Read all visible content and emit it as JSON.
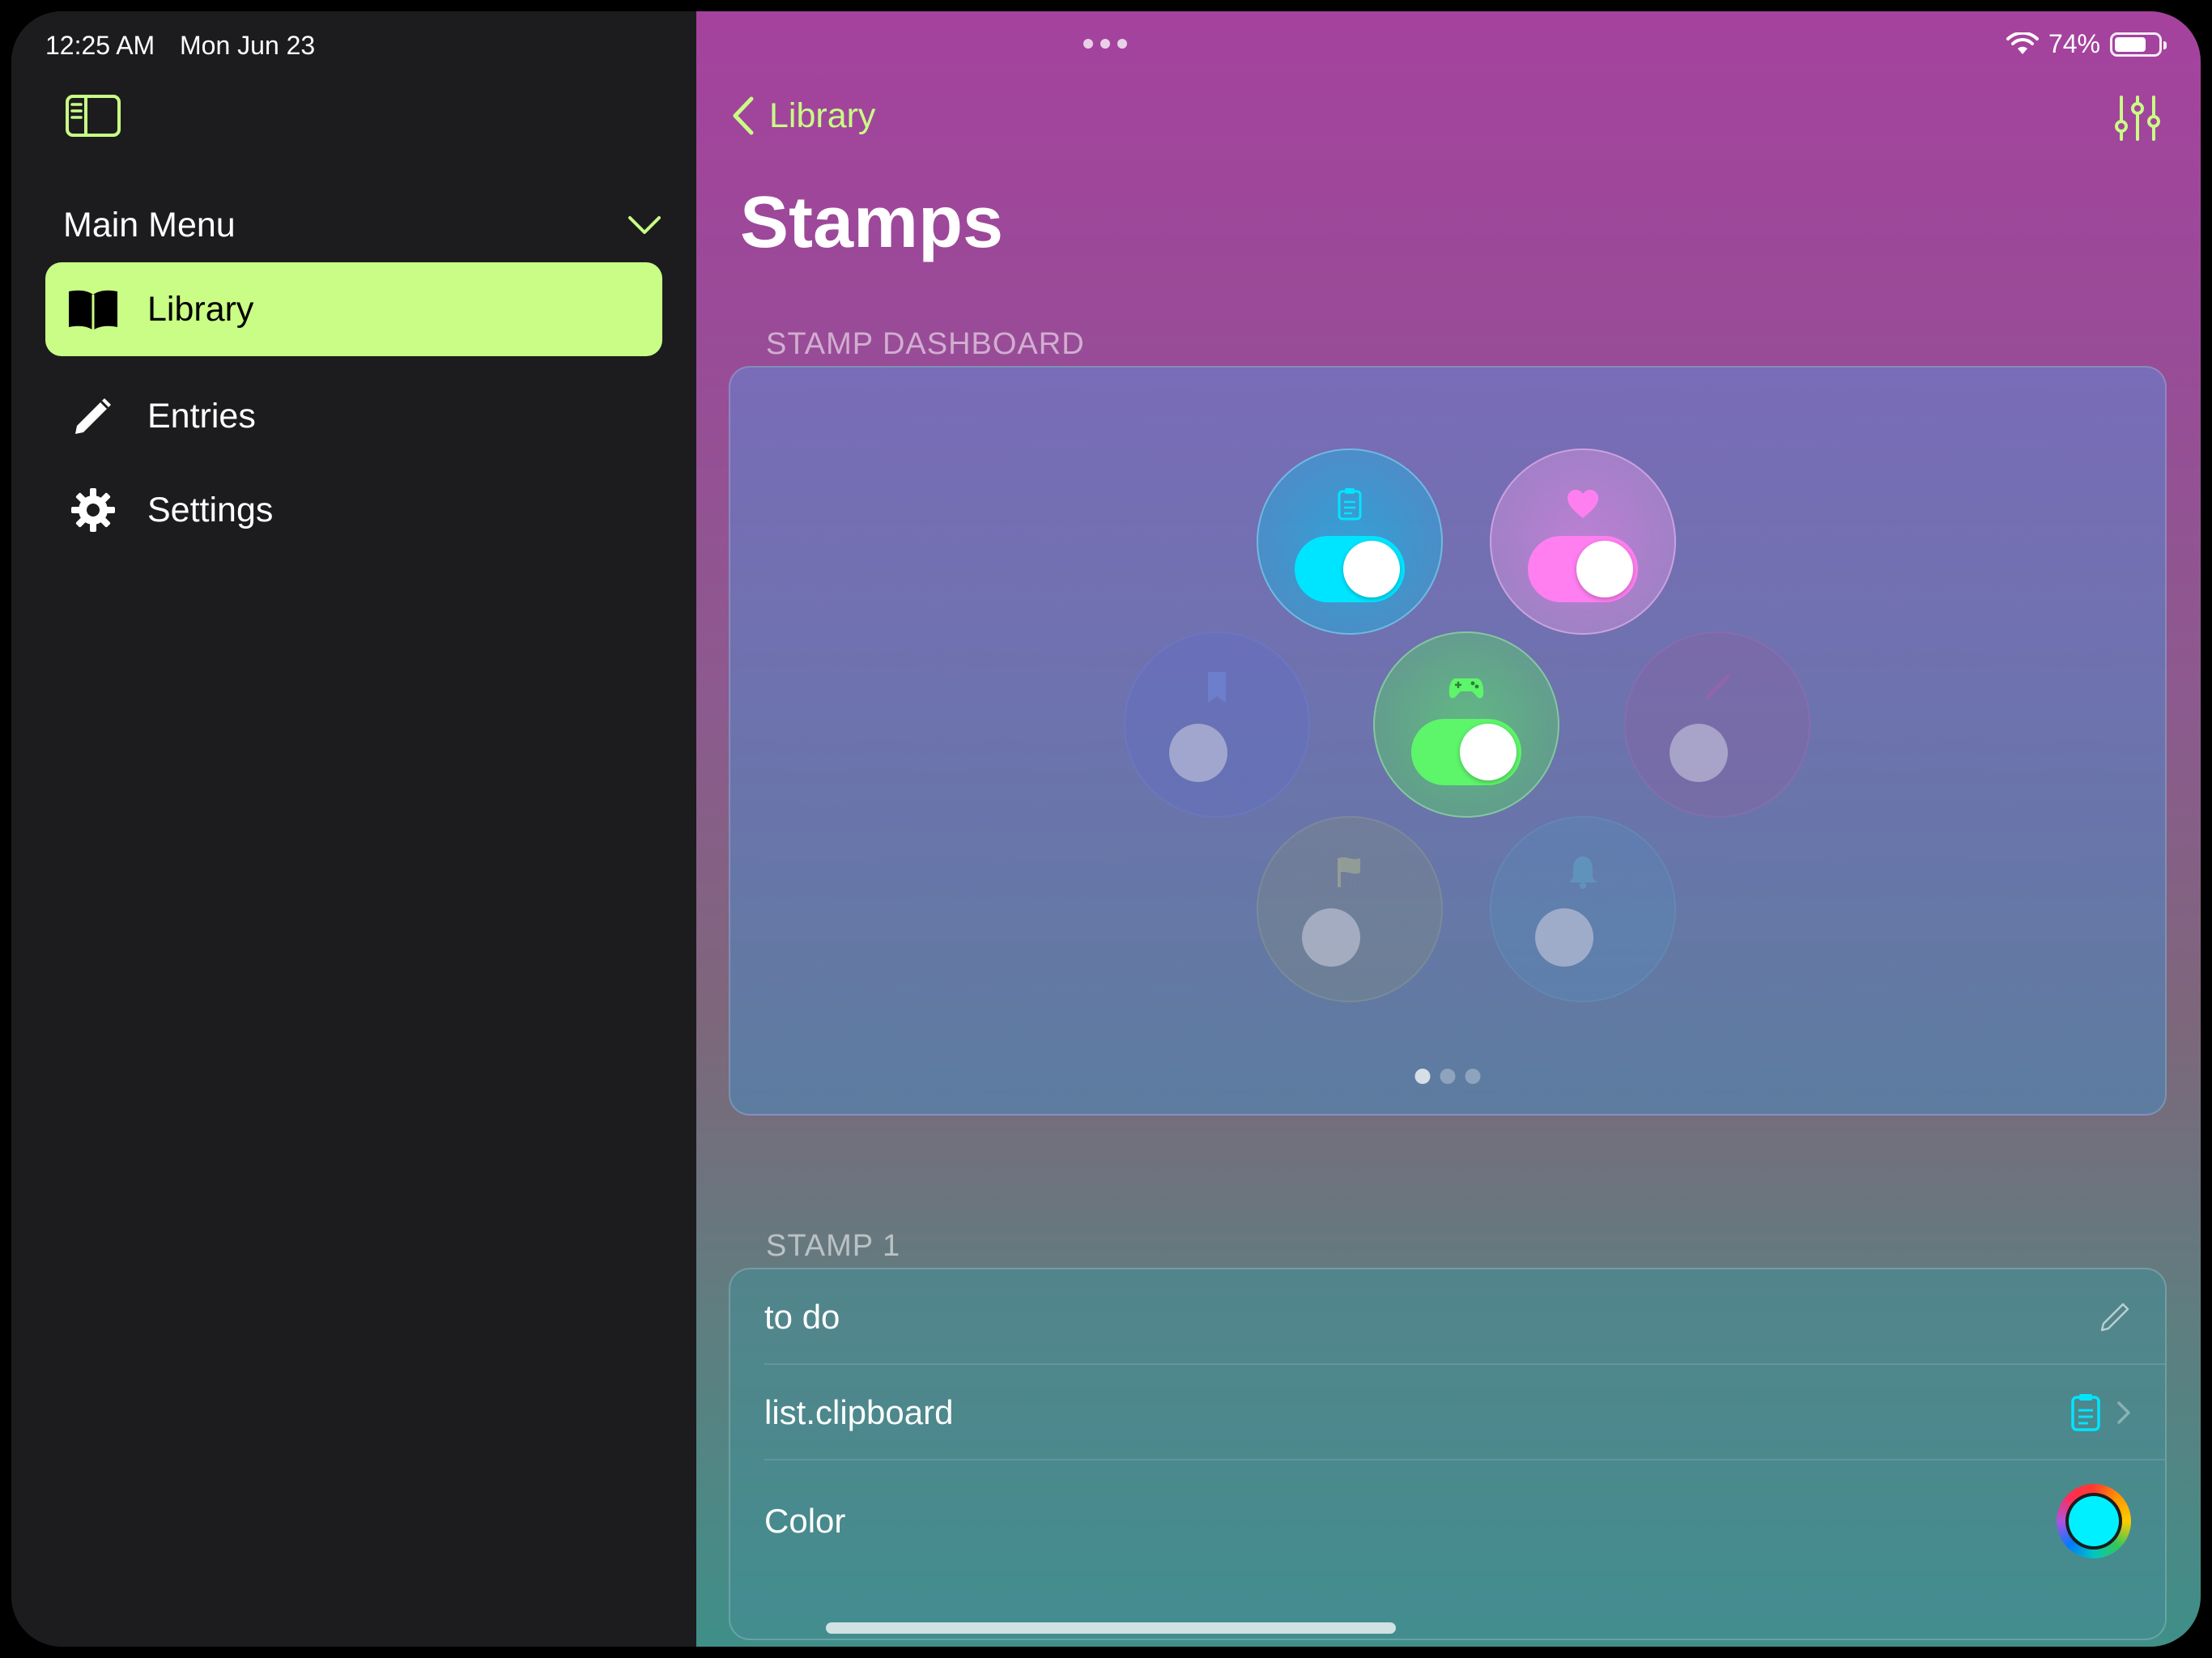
{
  "status_bar": {
    "time": "12:25 AM",
    "date": "Mon Jun 23",
    "battery": "74%",
    "battery_level": 0.74
  },
  "sidebar": {
    "toggle_icon": "sidebar-left-icon",
    "menu_header": "Main Menu",
    "items": [
      {
        "label": "Library",
        "icon": "book-icon",
        "active": true
      },
      {
        "label": "Entries",
        "icon": "pencil-icon",
        "active": false
      },
      {
        "label": "Settings",
        "icon": "gear-icon",
        "active": false
      }
    ]
  },
  "detail": {
    "back_label": "Library",
    "title": "Stamps",
    "dashboard_header": "STAMP DASHBOARD",
    "stamps": [
      {
        "icon": "clipboard-icon",
        "on": true,
        "color": "#00e5ff"
      },
      {
        "icon": "heart-icon",
        "on": true,
        "color": "#ff7ef0"
      },
      {
        "icon": "bookmark-icon",
        "on": false,
        "color": "#5b6fc4"
      },
      {
        "icon": "gamecontroller-icon",
        "on": true,
        "color": "#5df56a"
      },
      {
        "icon": "pencil-icon",
        "on": false,
        "color": "#8a5ea0"
      },
      {
        "icon": "flag-icon",
        "on": false,
        "color": "#8a9a8a"
      },
      {
        "icon": "bell-icon",
        "on": false,
        "color": "#5a8fb0"
      }
    ],
    "page_index": 1,
    "page_count": 3,
    "stamp_section_header": "STAMP 1",
    "stamp_rows": {
      "name": "to do",
      "symbol": "list.clipboard",
      "color_label": "Color",
      "color_value": "#00f0ff"
    }
  },
  "colors": {
    "accent": "#c9fd85",
    "sidebar_bg": "#1c1c1e"
  }
}
